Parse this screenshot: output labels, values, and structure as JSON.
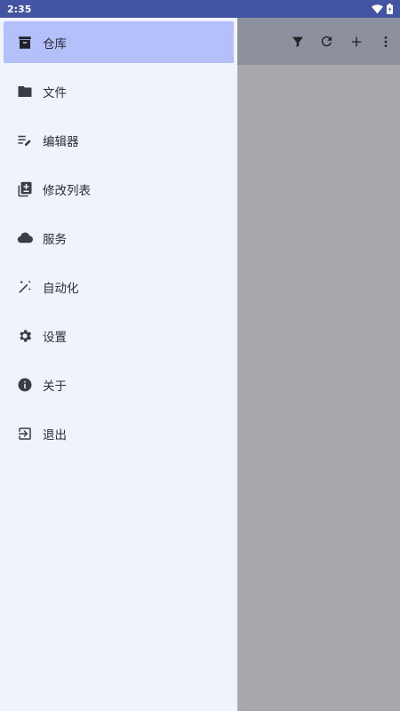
{
  "status_bar": {
    "time": "2:35"
  },
  "toolbar": {
    "actions": [
      "filter-icon",
      "refresh-icon",
      "add-icon",
      "more-vert-icon"
    ]
  },
  "drawer": {
    "items": [
      {
        "label": "仓库",
        "icon": "archive-icon",
        "active": true
      },
      {
        "label": "文件",
        "icon": "folder-icon"
      },
      {
        "label": "编辑器",
        "icon": "edit-note-icon"
      },
      {
        "label": "修改列表",
        "icon": "changelist-icon"
      },
      {
        "label": "服务",
        "icon": "cloud-icon"
      },
      {
        "label": "自动化",
        "icon": "magic-wand-icon"
      },
      {
        "label": "设置",
        "icon": "gear-icon"
      },
      {
        "label": "关于",
        "icon": "info-icon"
      },
      {
        "label": "退出",
        "icon": "exit-icon"
      }
    ]
  },
  "colors": {
    "status_bar": "#4355A2",
    "drawer_bg": "#F1F3FC",
    "active_item": "#B3C0FA",
    "scrim": "#A8A9AC"
  }
}
